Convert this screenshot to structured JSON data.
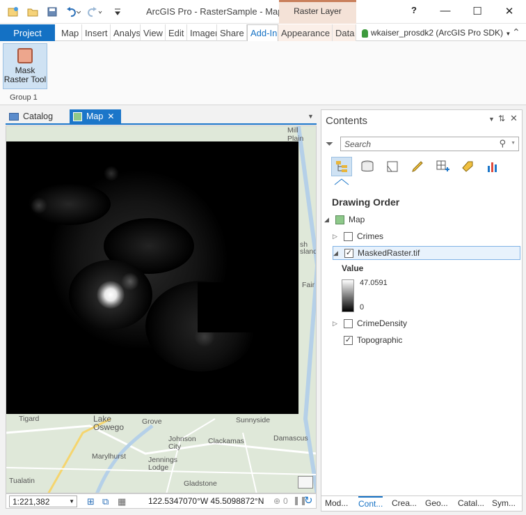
{
  "app": {
    "title": "ArcGIS Pro - RasterSample - Map",
    "contextual_tab": "Raster Layer",
    "help_label": "?",
    "user": "wkaiser_prosdk2 (ArcGIS Pro SDK)"
  },
  "ribbon": {
    "tabs": [
      "Project",
      "Map",
      "Insert",
      "Analysis",
      "View",
      "Edit",
      "Imagery",
      "Share",
      "Add-In",
      "Appearance",
      "Data"
    ],
    "active_tab": "Add-In",
    "tool": {
      "label_line1": "Mask",
      "label_line2": "Raster Tool"
    },
    "group_label": "Group 1"
  },
  "panes": {
    "catalog_tab": "Catalog",
    "map_tab": "Map"
  },
  "map": {
    "labels": [
      "Mill Plain",
      "Tigard",
      "Lake Oswego",
      "Grove",
      "Johnson City",
      "Clackamas",
      "Sunnyside",
      "Damascus",
      "Marylhurst",
      "Jennings Lodge",
      "Gladstone",
      "Tualatin",
      "Fair",
      "sland",
      "sh"
    ]
  },
  "status": {
    "scale": "1:221,382",
    "coordinates": "122.5347070°W 45.5098872°N",
    "selected_count": "0"
  },
  "contents": {
    "title": "Contents",
    "search_placeholder": "Search",
    "section": "Drawing Order",
    "map_item": "Map",
    "layers": [
      {
        "name": "Crimes",
        "checked": false
      },
      {
        "name": "MaskedRaster.tif",
        "checked": true
      },
      {
        "name": "CrimeDensity",
        "checked": false
      },
      {
        "name": "Topographic",
        "checked": true
      }
    ],
    "legend": {
      "heading": "Value",
      "max": "47.0591",
      "min": "0"
    },
    "bottom_tabs": [
      "Mod...",
      "Cont...",
      "Crea...",
      "Geo...",
      "Catal...",
      "Sym..."
    ],
    "active_bottom_tab": "Cont..."
  },
  "colors": {
    "accent": "#1471c4",
    "context_tab": "#f4e2d7"
  }
}
